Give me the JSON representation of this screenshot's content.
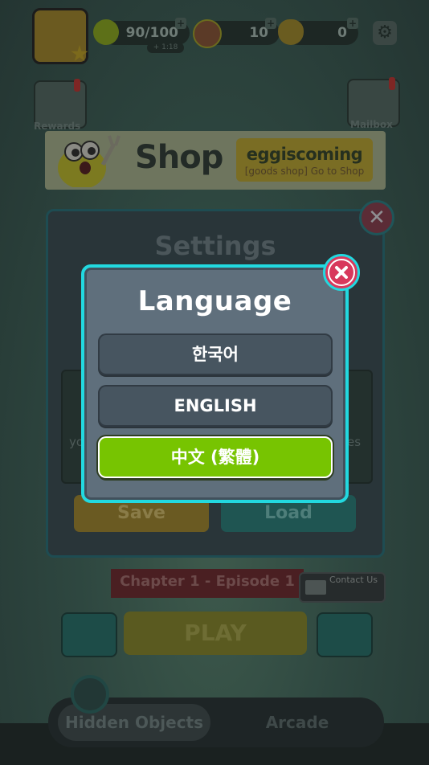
{
  "hud": {
    "energy": "90/100",
    "energy_sub": "+ 1:18",
    "coins": "10",
    "eggs": "0"
  },
  "side": {
    "rewards_label": "Rewards",
    "mailbox_label": "Mailbox"
  },
  "shop_banner": {
    "title": "Shop",
    "brand": "eggiscoming",
    "subtitle": "[goods shop] Go to Shop"
  },
  "settings": {
    "title": "Settings",
    "row_text_left": "yo",
    "row_text_right": "es",
    "save_label": "Save",
    "load_label": "Load"
  },
  "lobby": {
    "chapter": "Chapter 1 - Episode 1",
    "contact_label": "Contact Us",
    "play_label": "PLAY",
    "tab_hidden": "Hidden Objects",
    "tab_arcade": "Arcade"
  },
  "language_dialog": {
    "title": "Language",
    "options": [
      "한국어",
      "ENGLISH",
      "中文 (繁體)"
    ],
    "selected": "中文 (繁體)",
    "accent": "#22d9e0",
    "selected_color": "#77c401",
    "close_color": "#d8385c"
  }
}
